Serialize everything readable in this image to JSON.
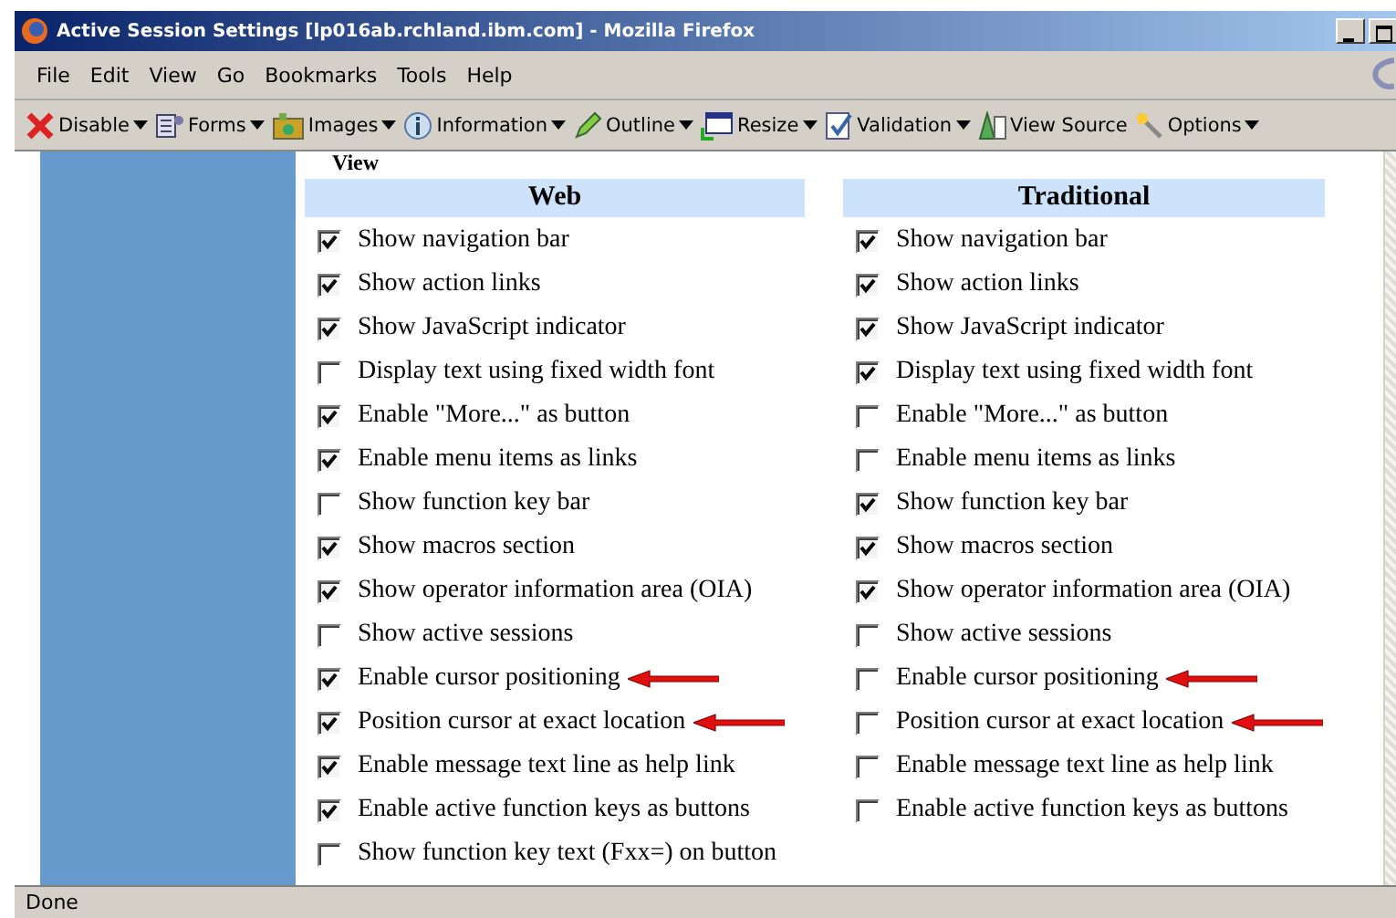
{
  "window": {
    "title": "Active Session Settings [lp016ab.rchland.ibm.com] - Mozilla Firefox"
  },
  "menu": [
    "File",
    "Edit",
    "View",
    "Go",
    "Bookmarks",
    "Tools",
    "Help"
  ],
  "toolbar": [
    {
      "label": "Disable",
      "kind": "cross",
      "dropdown": true
    },
    {
      "label": "Forms",
      "kind": "form",
      "dropdown": true
    },
    {
      "label": "Images",
      "kind": "image",
      "dropdown": true
    },
    {
      "label": "Information",
      "kind": "info",
      "dropdown": true
    },
    {
      "label": "Outline",
      "kind": "pencil",
      "dropdown": true
    },
    {
      "label": "Resize",
      "kind": "resize",
      "dropdown": true
    },
    {
      "label": "Validation",
      "kind": "check",
      "dropdown": true
    },
    {
      "label": "View Source",
      "kind": "source",
      "dropdown": false
    },
    {
      "label": "Options",
      "kind": "wand",
      "dropdown": true
    }
  ],
  "section_heading": "View",
  "columns": [
    {
      "heading": "Web",
      "options": [
        {
          "label": "Show navigation bar",
          "checked": true,
          "arrow": false
        },
        {
          "label": "Show action links",
          "checked": true,
          "arrow": false
        },
        {
          "label": "Show JavaScript indicator",
          "checked": true,
          "arrow": false
        },
        {
          "label": "Display text using fixed width font",
          "checked": false,
          "arrow": false
        },
        {
          "label": "Enable \"More...\" as button",
          "checked": true,
          "arrow": false
        },
        {
          "label": "Enable menu items as links",
          "checked": true,
          "arrow": false
        },
        {
          "label": "Show function key bar",
          "checked": false,
          "arrow": false
        },
        {
          "label": "Show macros section",
          "checked": true,
          "arrow": false
        },
        {
          "label": "Show operator information area (OIA)",
          "checked": true,
          "arrow": false
        },
        {
          "label": "Show active sessions",
          "checked": false,
          "arrow": false
        },
        {
          "label": "Enable cursor positioning",
          "checked": true,
          "arrow": true
        },
        {
          "label": "Position cursor at exact location",
          "checked": true,
          "arrow": true
        },
        {
          "label": "Enable message text line as help link",
          "checked": true,
          "arrow": false
        },
        {
          "label": "Enable active function keys as buttons",
          "checked": true,
          "arrow": false
        },
        {
          "label": "Show function key text (Fxx=) on button",
          "checked": false,
          "arrow": false
        }
      ]
    },
    {
      "heading": "Traditional",
      "options": [
        {
          "label": "Show navigation bar",
          "checked": true,
          "arrow": false
        },
        {
          "label": "Show action links",
          "checked": true,
          "arrow": false
        },
        {
          "label": "Show JavaScript indicator",
          "checked": true,
          "arrow": false
        },
        {
          "label": "Display text using fixed width font",
          "checked": true,
          "arrow": false
        },
        {
          "label": "Enable \"More...\" as button",
          "checked": false,
          "arrow": false
        },
        {
          "label": "Enable menu items as links",
          "checked": false,
          "arrow": false
        },
        {
          "label": "Show function key bar",
          "checked": true,
          "arrow": false
        },
        {
          "label": "Show macros section",
          "checked": true,
          "arrow": false
        },
        {
          "label": "Show operator information area (OIA)",
          "checked": true,
          "arrow": false
        },
        {
          "label": "Show active sessions",
          "checked": false,
          "arrow": false
        },
        {
          "label": "Enable cursor positioning",
          "checked": false,
          "arrow": true
        },
        {
          "label": "Position cursor at exact location",
          "checked": false,
          "arrow": true
        },
        {
          "label": "Enable message text line as help link",
          "checked": false,
          "arrow": false
        },
        {
          "label": "Enable active function keys as buttons",
          "checked": false,
          "arrow": false
        }
      ]
    }
  ],
  "status_bar": "Done"
}
